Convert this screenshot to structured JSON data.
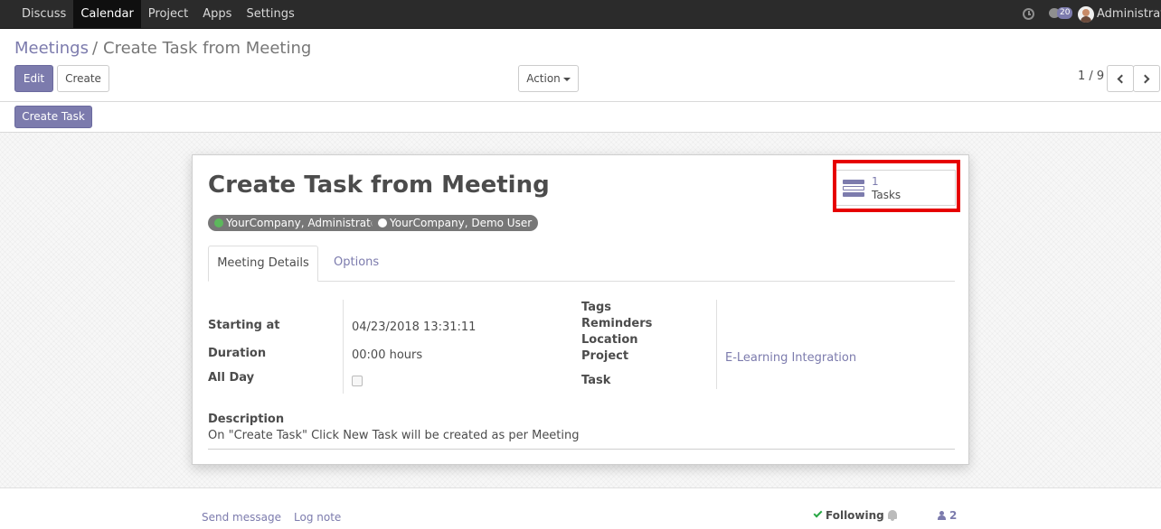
{
  "topbar": {
    "menu": [
      {
        "label": "Discuss",
        "active": false
      },
      {
        "label": "Calendar",
        "active": true
      },
      {
        "label": "Project",
        "active": false
      },
      {
        "label": "Apps",
        "active": false
      },
      {
        "label": "Settings",
        "active": false
      }
    ],
    "systray": {
      "clock_icon": "clock-icon",
      "chat_icon": "chat-icon",
      "message_count": "20",
      "user_name": "Administrator"
    }
  },
  "control_panel": {
    "breadcrumb": {
      "parent": "Meetings",
      "separator": "/",
      "current": "Create Task from Meeting"
    },
    "buttons": {
      "edit": "Edit",
      "create": "Create",
      "action": "Action"
    },
    "pager": {
      "value": "1 / 9"
    }
  },
  "header": {
    "create_task_button": "Create Task"
  },
  "form": {
    "smart_button": {
      "value": "1",
      "label": "Tasks",
      "icon": "tasks-icon"
    },
    "title": "Create Task from Meeting",
    "attendees": [
      {
        "name": "YourCompany, Administrator",
        "status_color": "#5cb85c"
      },
      {
        "name": "YourCompany, Demo User",
        "status_color": "#ffffff"
      }
    ],
    "tabs": {
      "meeting_details": "Meeting Details",
      "options": "Options"
    },
    "left_fields": {
      "starting_at_label": "Starting at",
      "starting_at_value": "04/23/2018 13:31:11",
      "duration_label": "Duration",
      "duration_value": "00:00 hours",
      "all_day_label": "All Day",
      "all_day_checked": false
    },
    "right_fields": {
      "tags_label": "Tags",
      "reminders_label": "Reminders",
      "location_label": "Location",
      "project_label": "Project",
      "project_value": "E-Learning Integration",
      "task_label": "Task"
    },
    "description": {
      "label": "Description",
      "value": "On \"Create Task\" Click New Task will be created as per Meeting"
    }
  },
  "chatter": {
    "send_message": "Send message",
    "log_note": "Log note",
    "following": "Following",
    "followers_count": "2"
  },
  "colors": {
    "accent": "#7c7bad",
    "highlight": "#e60000",
    "navbar": "#2b2b2b"
  }
}
